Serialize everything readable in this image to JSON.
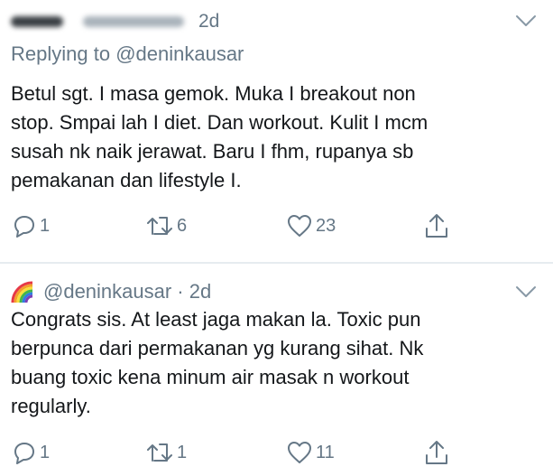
{
  "tweet1": {
    "time": "2d",
    "replying_prefix": "Replying to ",
    "replying_handle": "@deninkausar",
    "body_lines": [
      "Betul sgt. I masa gemok. Muka I breakout non",
      "stop. Smpai lah I diet. Dan workout. Kulit I mcm",
      "susah nk naik jerawat. Baru I fhm, rupanya sb",
      "pemakanan dan lifestyle I."
    ],
    "reply_count": "1",
    "retweet_count": "6",
    "like_count": "23"
  },
  "tweet2": {
    "handle_time": "@deninkausar · 2d",
    "body_lines": [
      "Congrats sis. At least jaga makan la. Toxic pun",
      "berpunca dari permakanan yg kurang sihat. Nk",
      "buang toxic kena minum air masak n workout",
      "regularly."
    ],
    "reply_count": "1",
    "retweet_count": "1",
    "like_count": "11"
  },
  "colors": {
    "text": "#14171a",
    "muted": "#657786",
    "divider": "#e6ecf0"
  },
  "icons": [
    "chevron-down-icon",
    "reply-icon",
    "retweet-icon",
    "like-icon",
    "share-icon",
    "rainbow-icon"
  ]
}
